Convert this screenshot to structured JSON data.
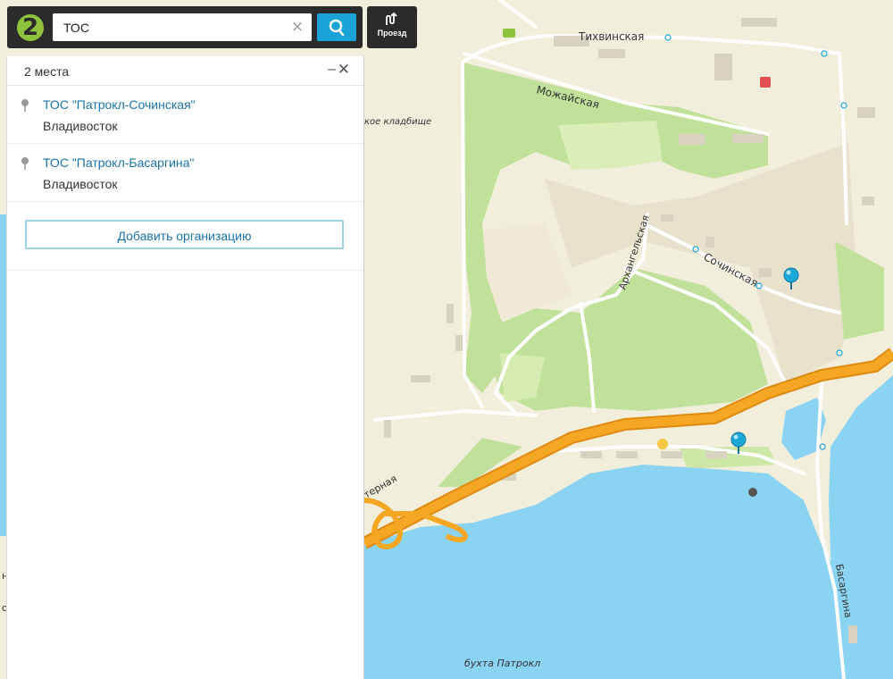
{
  "logo": {
    "glyph": "2"
  },
  "search": {
    "value": "ТОС",
    "clear_glyph": "×"
  },
  "route_button": {
    "label": "Проезд"
  },
  "results": {
    "count_label": "2 места",
    "minimize_glyph": "–",
    "close_glyph": "✕",
    "items": [
      {
        "title": "ТОС \"Патрокл-Сочинская\"",
        "city": "Владивосток"
      },
      {
        "title": "ТОС \"Патрокл-Басаргина\"",
        "city": "Владивосток"
      }
    ],
    "add_org_label": "Добавить организацию"
  },
  "map": {
    "labels": {
      "tikhvinskaya": "Тихвинская",
      "mozhayskaya": "Можайская",
      "cemetery": "кое кладбище",
      "arkhangelskaya": "Архангельская",
      "sochinskaya": "Сочинская",
      "basargina": "Басаргина",
      "bay": "бухта Патрокл",
      "edge_street": "терная",
      "edge_left_1": "н",
      "edge_left_2": "о"
    }
  },
  "colors": {
    "land": "#f2eedc",
    "park": "#c1e19a",
    "water": "#8bd3f3",
    "highway": "#f29b17",
    "pin": "#1ca8d8",
    "brand": "#8fc33d"
  }
}
